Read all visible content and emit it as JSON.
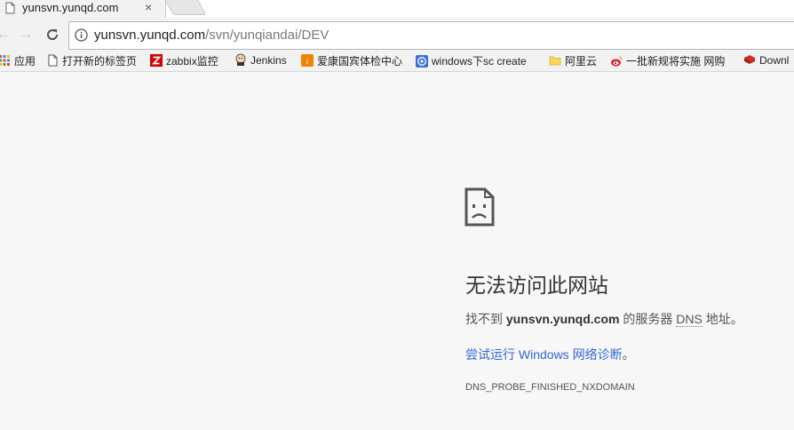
{
  "tab": {
    "title": "yunsvn.yunqd.com",
    "close": "×"
  },
  "toolbar": {
    "back": "←",
    "forward": "→"
  },
  "address": {
    "host": "yunsvn.yunqd.com",
    "path": "/svn/yunqiandai/DEV"
  },
  "bookmarks": [
    {
      "label": "应用",
      "icon": "apps-grid-icon"
    },
    {
      "label": "打开新的标签页",
      "icon": "page-icon"
    },
    {
      "label": "zabbix监控",
      "icon": "zabbix-icon"
    },
    {
      "label": "Jenkins",
      "icon": "jenkins-icon"
    },
    {
      "label": "爱康国宾体检中心",
      "icon": "ikang-icon"
    },
    {
      "label": "windows下sc create",
      "icon": "globe-icon"
    },
    {
      "label": "阿里云",
      "icon": "folder-icon"
    },
    {
      "label": "一批新规将实施 网购",
      "icon": "weibo-icon"
    },
    {
      "label": "Downl",
      "icon": "redis-icon"
    }
  ],
  "error": {
    "title": "无法访问此网站",
    "prefix": "找不到 ",
    "host": "yunsvn.yunqd.com",
    "mid": " 的服务器 ",
    "dns": "DNS",
    "suffix": " 地址。",
    "link": "尝试运行 Windows 网络诊断",
    "link_tail": "。",
    "code": "DNS_PROBE_FINISHED_NXDOMAIN"
  },
  "colors": {
    "link": "#3367d6",
    "background": "#f7f7f7"
  }
}
